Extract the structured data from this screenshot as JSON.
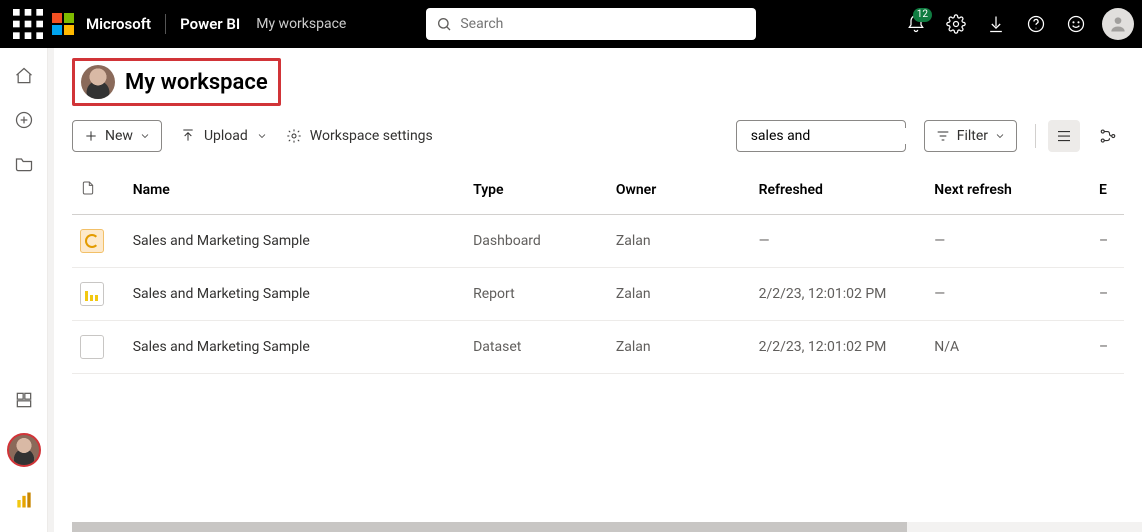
{
  "topbar": {
    "brand_company": "Microsoft",
    "brand_app": "Power BI",
    "breadcrumb": "My workspace",
    "search_placeholder": "Search",
    "notification_count": "12"
  },
  "workspace": {
    "title": "My workspace"
  },
  "commands": {
    "new_label": "New",
    "upload_label": "Upload",
    "settings_label": "Workspace settings",
    "filter_label": "Filter",
    "search_value": "sales and"
  },
  "table": {
    "columns": {
      "name": "Name",
      "type": "Type",
      "owner": "Owner",
      "refreshed": "Refreshed",
      "next_refresh": "Next refresh",
      "extra": "E"
    },
    "rows": [
      {
        "name": "Sales and Marketing Sample",
        "type": "Dashboard",
        "owner": "Zalan",
        "refreshed": "—",
        "next_refresh": "—",
        "extra": "–"
      },
      {
        "name": "Sales and Marketing Sample",
        "type": "Report",
        "owner": "Zalan",
        "refreshed": "2/2/23, 12:01:02 PM",
        "next_refresh": "—",
        "extra": "–"
      },
      {
        "name": "Sales and Marketing Sample",
        "type": "Dataset",
        "owner": "Zalan",
        "refreshed": "2/2/23, 12:01:02 PM",
        "next_refresh": "N/A",
        "extra": "–"
      }
    ]
  }
}
